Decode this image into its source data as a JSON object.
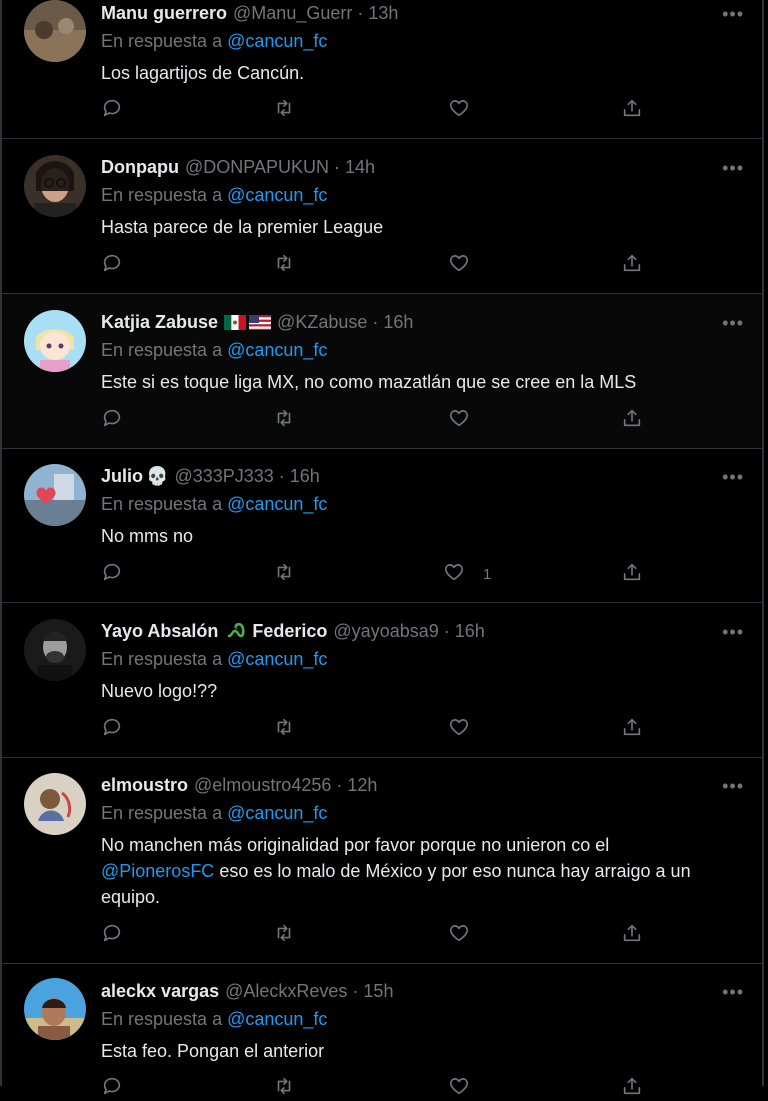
{
  "colors": {
    "background": "#000000",
    "text": "#e7e9ea",
    "muted": "#71767b",
    "link": "#1d9bf0",
    "border": "#2f3336"
  },
  "reply_prefix": "En respuesta a",
  "reply_handle": "@cancun_fc",
  "more_label": "•••",
  "tweets": [
    {
      "name": "Manu guerrero",
      "handle": "@Manu_Guerr",
      "time": "13h",
      "text": "Los lagartijos de Cancún.",
      "likes": ""
    },
    {
      "name": "Donpapu",
      "handle": "@DONPAPUKUN",
      "time": "14h",
      "text": "Hasta parece de la premier League",
      "likes": ""
    },
    {
      "name": "Katjia Zabuse",
      "name_flags": [
        "mexico-flag",
        "usa-flag"
      ],
      "handle": "@KZabuse",
      "time": "16h",
      "text": "Este si es toque liga MX, no como mazatlán que se cree en la MLS",
      "likes": ""
    },
    {
      "name": "Julio",
      "name_emoji": "💀",
      "handle": "@333PJ333",
      "time": "16h",
      "text": "No mms no",
      "likes": "1"
    },
    {
      "name": "Yayo Absalón",
      "name_emoji": "ᘓ",
      "name_suffix": "Federico",
      "handle": "@yayoabsa9",
      "time": "16h",
      "text": "Nuevo logo!??",
      "likes": ""
    },
    {
      "name": "elmoustro",
      "handle": "@elmoustro4256",
      "time": "12h",
      "text_line1": "No manchen más originalidad por favor porque no unieron co el",
      "text_mention": "@PionerosFC",
      "text_rest": " eso es lo malo de México y por eso nunca hay arraigo a un equipo.",
      "likes": ""
    },
    {
      "name": "aleckx vargas",
      "handle": "@AleckxReves",
      "time": "15h",
      "text": "Esta feo. Pongan el anterior",
      "likes": ""
    }
  ],
  "icons": {
    "reply": "reply-icon",
    "retweet": "retweet-icon",
    "like": "like-icon",
    "share": "share-icon",
    "more": "more-icon"
  }
}
